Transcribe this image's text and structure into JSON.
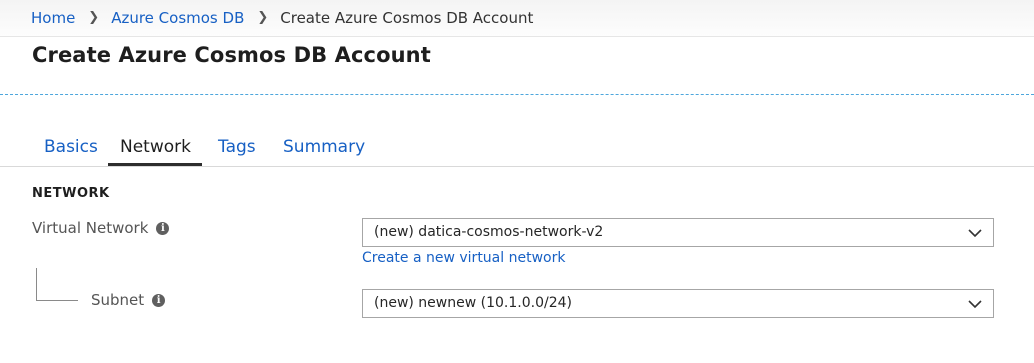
{
  "breadcrumb": {
    "home": "Home",
    "parent": "Azure Cosmos DB",
    "current": "Create Azure Cosmos DB Account"
  },
  "page_title": "Create Azure Cosmos DB Account",
  "tabs": [
    {
      "label": "Basics",
      "active": false
    },
    {
      "label": "Network",
      "active": true
    },
    {
      "label": "Tags",
      "active": false
    },
    {
      "label": "Summary",
      "active": false
    }
  ],
  "network": {
    "section_title": "NETWORK",
    "virtual_network": {
      "label": "Virtual Network",
      "value": "(new) datica-cosmos-network-v2",
      "create_link": "Create a new virtual network"
    },
    "subnet": {
      "label": "Subnet",
      "value": "(new) newnew (10.1.0.0/24)"
    }
  },
  "colors": {
    "link": "#1760c4",
    "accent_dashed": "#4ea6dc",
    "active_tab_underline": "#2d2d2d"
  },
  "icons": [
    "chevron-right-icon",
    "info-icon",
    "chevron-down-icon"
  ]
}
